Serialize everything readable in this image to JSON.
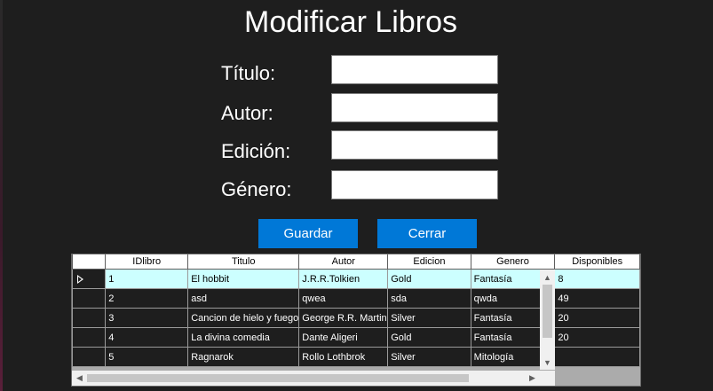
{
  "form": {
    "title": "Modificar Libros",
    "fields": [
      {
        "label": "Título:",
        "value": ""
      },
      {
        "label": "Autor:",
        "value": ""
      },
      {
        "label": "Edición:",
        "value": ""
      },
      {
        "label": "Género:",
        "value": ""
      }
    ],
    "buttons": {
      "save": "Guardar",
      "close": "Cerrar"
    }
  },
  "grid": {
    "columns": [
      "IDlibro",
      "Titulo",
      "Autor",
      "Edicion",
      "Genero",
      "Disponibles"
    ],
    "rows": [
      [
        "1",
        "El hobbit",
        "J.R.R.Tolkien",
        "Gold",
        "Fantasía",
        "8"
      ],
      [
        "2",
        "asd",
        "qwea",
        "sda",
        "qwda",
        "49"
      ],
      [
        "3",
        "Cancion de hielo y fuego",
        "George R.R. Martin",
        "Silver",
        "Fantasía",
        "20"
      ],
      [
        "4",
        "La divina comedia",
        "Dante Aligeri",
        "Gold",
        "Fantasía",
        "20"
      ],
      [
        "5",
        "Ragnarok",
        "Rollo Lothbrok",
        "Silver",
        "Mitología",
        ""
      ]
    ],
    "selected_row": 0,
    "icons": {
      "row_pointer": "row-pointer-icon",
      "scroll_up": "up-arrow-icon",
      "scroll_down": "down-arrow-icon",
      "scroll_left": "left-arrow-icon",
      "scroll_right": "right-arrow-icon"
    }
  },
  "colors": {
    "background": "#1e1e1e",
    "button": "#0078d7",
    "selected_row": "#ccffff"
  }
}
